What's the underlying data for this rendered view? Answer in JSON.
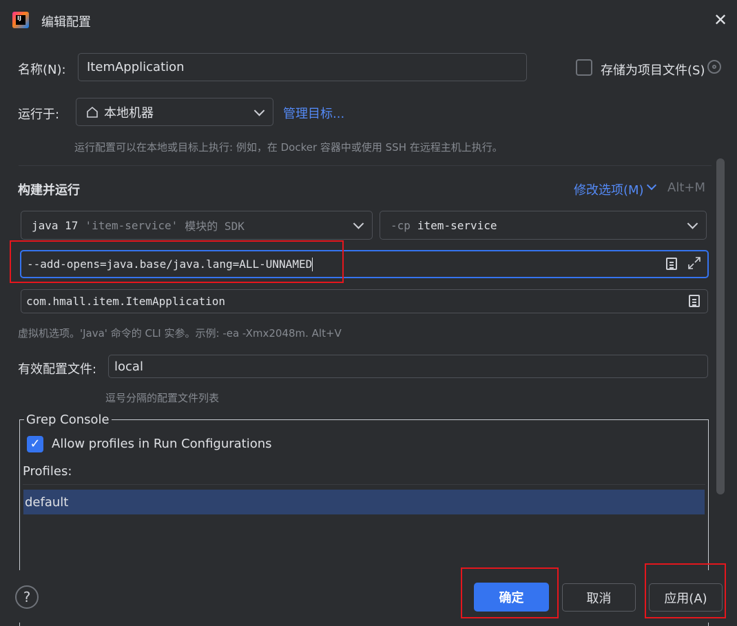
{
  "window": {
    "title": "编辑配置",
    "close_icon": "close-icon",
    "app_icon": "intellij-icon"
  },
  "name_row": {
    "label": "名称(N):",
    "value": "ItemApplication",
    "store_as_file_label": "存储为项目文件(S)",
    "store_checked": false
  },
  "run_on": {
    "label": "运行于:",
    "value": "本地机器",
    "manage_link": "管理目标...",
    "hint": "运行配置可以在本地或目标上执行: 例如，在 Docker 容器中或使用 SSH 在远程主机上执行。"
  },
  "build_run": {
    "section_title": "构建并运行",
    "modify_options": "修改选项(M)",
    "modify_shortcut": "Alt+M",
    "sdk_java": "java 17",
    "sdk_module": "'item-service'",
    "sdk_suffix": "模块的 SDK",
    "cp_prefix": "-cp",
    "cp_value": "item-service",
    "vm_options": "--add-opens=java.base/java.lang=ALL-UNNAMED",
    "main_class": "com.hmall.item.ItemApplication",
    "vm_hint": "虚拟机选项。'Java' 命令的 CLI 实参。示例: -ea -Xmx2048m. Alt+V"
  },
  "profiles_row": {
    "label": "有效配置文件:",
    "value": "local",
    "hint": "逗号分隔的配置文件列表"
  },
  "grep_console": {
    "title": "Grep Console",
    "allow_label": "Allow profiles in Run Configurations",
    "allow_checked": true,
    "profiles_label": "Profiles:",
    "profiles": [
      "default"
    ]
  },
  "footer": {
    "help": "?",
    "ok": "确定",
    "cancel": "取消",
    "apply": "应用(A)"
  },
  "colors": {
    "accent": "#3574f0",
    "link": "#548af7",
    "highlight": "#e5161d",
    "selection": "#2e436e"
  }
}
